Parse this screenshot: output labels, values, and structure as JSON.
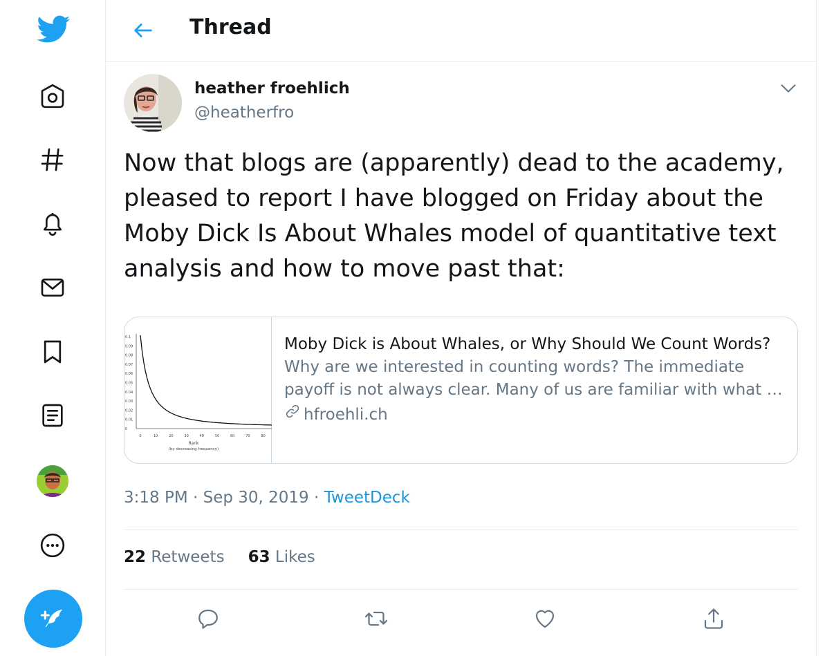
{
  "header": {
    "title": "Thread"
  },
  "tweet": {
    "name": "heather froehlich",
    "handle": "@heatherfro",
    "text": "Now that blogs are (apparently) dead to the academy, pleased to report I have blogged on Friday about the Moby Dick Is About Whales model of quantitative text analysis and how to move past that:",
    "card": {
      "title": "Moby Dick is About Whales, or Why Should We Count Words?",
      "description": "Why are we interested in counting words? The immediate payoff is not always clear. Many of us are familiar with what …",
      "domain": "hfroehli.ch",
      "thumb": {
        "y_ticks": [
          "0.1",
          "0.09",
          "0.08",
          "0.07",
          "0.06",
          "0.05",
          "0.04",
          "0.03",
          "0.02",
          "0.01",
          "0"
        ],
        "x_ticks": [
          "0",
          "10",
          "20",
          "30",
          "40",
          "50",
          "60",
          "70",
          "80"
        ],
        "xlabel": "Rank",
        "xlabel2": "(by decreasing frequency)"
      }
    },
    "time": "3:18 PM · Sep 30, 2019",
    "separator": " · ",
    "source": "TweetDeck",
    "retweets": {
      "count": "22",
      "label": "Retweets"
    },
    "likes": {
      "count": "63",
      "label": "Likes"
    }
  },
  "icons": {
    "logo": "twitter-bird-icon",
    "nav": [
      "home-icon",
      "explore-hash-icon",
      "notifications-bell-icon",
      "messages-envelope-icon",
      "bookmarks-icon",
      "lists-icon",
      "profile-avatar",
      "more-icon"
    ],
    "compose": "compose-tweet-icon",
    "actions": [
      "reply-icon",
      "retweet-icon",
      "like-icon",
      "share-icon"
    ]
  },
  "colors": {
    "accent": "#1da1f2",
    "link": "#1b95e0",
    "muted": "#657786",
    "border": "#e6ecf0"
  }
}
